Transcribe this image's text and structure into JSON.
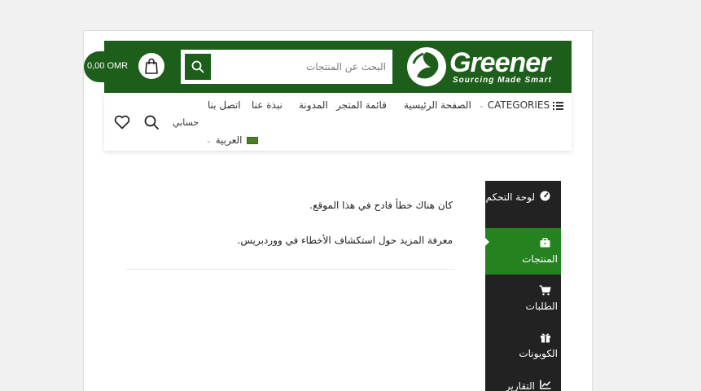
{
  "header": {
    "brand": "Greener",
    "tagline": "Sourcing Made Smart",
    "search_placeholder": "البحث عن المنتجات",
    "cart_total": "0,00 OMR"
  },
  "nav": {
    "categories_label": "CATEGORIES",
    "items": [
      "الصفحة الرئيسية",
      "قائمة المتجر",
      "المدونة",
      "نبذة عنا",
      "اتصل بنا"
    ],
    "account_label": "حسابي",
    "language_label": "العربية"
  },
  "main": {
    "error_message": "كان هناك خطأ فادح في هذا الموقع.",
    "help_link": "معرفة المزيد حول استكشاف الأخطاء في ووردبريس."
  },
  "sidebar": {
    "items": [
      {
        "label": "لوحة التحكم",
        "icon": "dashboard-icon"
      },
      {
        "label": "المنتجات",
        "icon": "briefcase-icon",
        "active": true
      },
      {
        "label": "الطلبات",
        "icon": "cart-icon"
      },
      {
        "label": "الكوبونات",
        "icon": "gift-icon"
      },
      {
        "label": "التقارير",
        "icon": "chart-icon"
      }
    ]
  },
  "colors": {
    "brand_green": "#1d5e1a",
    "active_green": "#25831f",
    "sidebar_dark": "#222222"
  }
}
